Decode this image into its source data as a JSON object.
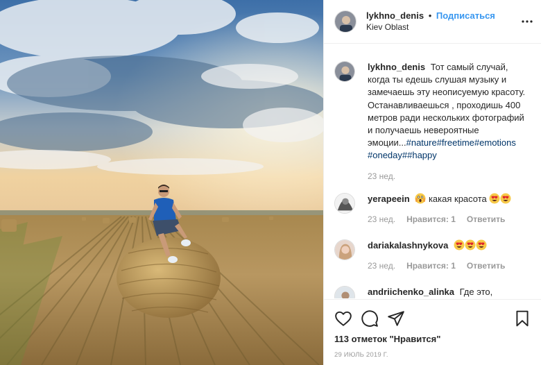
{
  "header": {
    "username": "lykhno_denis",
    "separator": "•",
    "follow_label": "Подписаться",
    "location": "Kiev Oblast"
  },
  "caption": {
    "username": "lykhno_denis",
    "text": "Тот самый случай, когда ты едешь слушая музыку и замечаешь эту неописуемую красоту. Останавливаешься , проходишь 400 метров ради нескольких фотографий и получаешь невероятные эмоции...",
    "hashtags": [
      "#nature",
      "#freetime",
      "#emotions",
      "#oneday",
      "##happy"
    ],
    "time": "23 нед."
  },
  "comments": [
    {
      "username": "yerapeein",
      "text": "какая красота",
      "emojis_before": [
        "scream-emoji"
      ],
      "emojis_after": [
        "heart-eyes-emoji",
        "heart-eyes-emoji"
      ],
      "time": "23 нед.",
      "likes_label": "Нравится: 1",
      "reply_label": "Ответить"
    },
    {
      "username": "dariakalashnykova",
      "text": "",
      "emojis_after": [
        "heart-eyes-emoji",
        "heart-eyes-emoji",
        "heart-eyes-emoji"
      ],
      "time": "23 нед.",
      "likes_label": "Нравится: 1",
      "reply_label": "Ответить"
    },
    {
      "username": "andriichenko_alinka",
      "text": "Где это,"
    }
  ],
  "actions": {
    "icons": [
      "heart-icon",
      "comment-icon",
      "share-icon",
      "bookmark-icon"
    ],
    "likes_count": "113 отметок \"Нравится\"",
    "date": "29 ИЮЛЬ 2019 Г."
  },
  "colors": {
    "link": "#3897f0",
    "hashtag": "#003569",
    "secondary_text": "#999999",
    "text": "#262626"
  }
}
